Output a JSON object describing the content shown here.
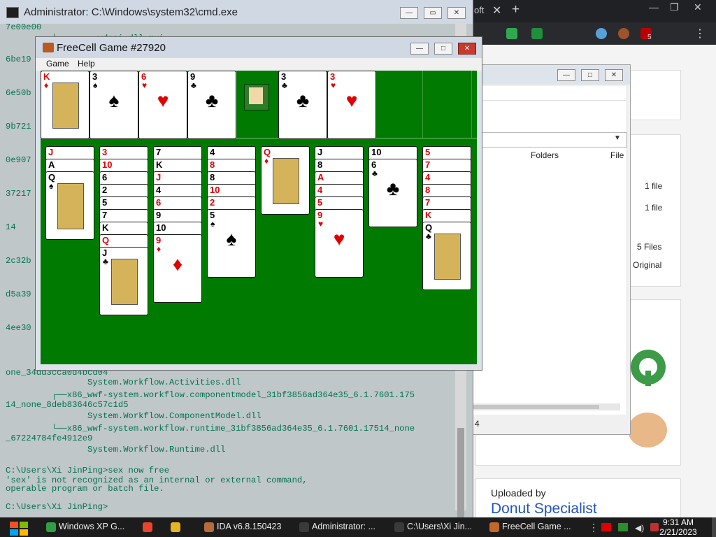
{
  "browser": {
    "tab_fragment": "oft",
    "close_tab": "✕",
    "new_tab": "+",
    "minimize": "—",
    "restore": "❐",
    "close": "✕",
    "badge_count": "5",
    "uploaded_by_label": "Uploaded by",
    "uploader_name": "Donut Specialist"
  },
  "explorer": {
    "columns": {
      "folders": "Folders",
      "file": "File"
    },
    "rows": [
      "1 file",
      "1 file",
      "5 Files",
      "Original"
    ],
    "status": "4",
    "minimize": "—",
    "maximize": "□",
    "close": "✕"
  },
  "cmd": {
    "title": "Administrator: C:\\Windows\\system32\\cmd.exe",
    "minimize": "—",
    "maximize": "▭",
    "close": "✕",
    "lines": [
      "7e00e00",
      "         │        wdapi.dll.mui",
      "6be19",
      "6e50b",
      "9b721",
      "0e907",
      "37217",
      "14",
      "2c32b",
      "d5a39",
      "4ee30",
      "one_34dd3cca0d4bcd04",
      "                System.Workflow.Activities.dll",
      "         ┌──x86_wwf-system.workflow.componentmodel_31bf3856ad364e35_6.1.7601.175",
      "14_none_8deb83646c57c1d5",
      "                System.Workflow.ComponentModel.dll",
      "         └──x86_wwf-system.workflow.runtime_31bf3856ad364e35_6.1.7601.17514_none",
      "_67224784fe4912e9",
      "                System.Workflow.Runtime.dll",
      "",
      "C:\\Users\\Xi JinPing>sex now free",
      "'sex' is not recognized as an internal or external command,",
      "operable program or batch file.",
      "",
      "C:\\Users\\Xi JinPing>"
    ]
  },
  "freecell": {
    "title": "FreeCell Game #27920",
    "menu": [
      "Game",
      "Help"
    ],
    "free_cells": [
      {
        "rank": "K",
        "suit": "♦",
        "color": "red"
      },
      {
        "rank": "3",
        "suit": "♠",
        "color": "blk"
      },
      {
        "rank": "6",
        "suit": "♥",
        "color": "red"
      },
      {
        "rank": "9",
        "suit": "♣",
        "color": "blk"
      }
    ],
    "foundations": [
      {
        "rank": "3",
        "suit": "♣",
        "color": "blk"
      },
      {
        "rank": "3",
        "suit": "♥",
        "color": "red"
      },
      null,
      null
    ],
    "columns": [
      [
        {
          "rank": "J",
          "suit": "♦",
          "color": "red"
        },
        {
          "rank": "A",
          "suit": "♠",
          "color": "blk"
        },
        {
          "rank": "Q",
          "suit": "♠",
          "color": "blk"
        }
      ],
      [
        {
          "rank": "3",
          "suit": "♦",
          "color": "red"
        },
        {
          "rank": "10",
          "suit": "♦",
          "color": "red"
        },
        {
          "rank": "6",
          "suit": "♠",
          "color": "blk"
        },
        {
          "rank": "2",
          "suit": "♠",
          "color": "blk"
        },
        {
          "rank": "5",
          "suit": "♠",
          "color": "blk"
        },
        {
          "rank": "7",
          "suit": "♠",
          "color": "blk"
        },
        {
          "rank": "K",
          "suit": "♠",
          "color": "blk"
        },
        {
          "rank": "Q",
          "suit": "♥",
          "color": "red"
        },
        {
          "rank": "J",
          "suit": "♣",
          "color": "blk"
        }
      ],
      [
        {
          "rank": "7",
          "suit": "♠",
          "color": "blk"
        },
        {
          "rank": "K",
          "suit": "♠",
          "color": "blk"
        },
        {
          "rank": "J",
          "suit": "♥",
          "color": "red"
        },
        {
          "rank": "4",
          "suit": "♠",
          "color": "blk"
        },
        {
          "rank": "6",
          "suit": "♦",
          "color": "red"
        },
        {
          "rank": "9",
          "suit": "♣",
          "color": "blk"
        },
        {
          "rank": "10",
          "suit": "♠",
          "color": "blk"
        },
        {
          "rank": "9",
          "suit": "♦",
          "color": "red"
        }
      ],
      [
        {
          "rank": "4",
          "suit": "♠",
          "color": "blk"
        },
        {
          "rank": "8",
          "suit": "♥",
          "color": "red"
        },
        {
          "rank": "8",
          "suit": "♠",
          "color": "blk"
        },
        {
          "rank": "10",
          "suit": "♥",
          "color": "red"
        },
        {
          "rank": "2",
          "suit": "♥",
          "color": "red"
        },
        {
          "rank": "5",
          "suit": "♠",
          "color": "blk"
        }
      ],
      [
        {
          "rank": "Q",
          "suit": "♦",
          "color": "red"
        }
      ],
      [
        {
          "rank": "J",
          "suit": "♠",
          "color": "blk"
        },
        {
          "rank": "8",
          "suit": "♣",
          "color": "blk"
        },
        {
          "rank": "A",
          "suit": "♦",
          "color": "red"
        },
        {
          "rank": "4",
          "suit": "♦",
          "color": "red"
        },
        {
          "rank": "5",
          "suit": "♦",
          "color": "red"
        },
        {
          "rank": "9",
          "suit": "♥",
          "color": "red"
        }
      ],
      [
        {
          "rank": "10",
          "suit": "♠",
          "color": "blk"
        },
        {
          "rank": "6",
          "suit": "♣",
          "color": "blk"
        }
      ],
      [
        {
          "rank": "5",
          "suit": "♦",
          "color": "red"
        },
        {
          "rank": "7",
          "suit": "♥",
          "color": "red"
        },
        {
          "rank": "4",
          "suit": "♥",
          "color": "red"
        },
        {
          "rank": "8",
          "suit": "♦",
          "color": "red"
        },
        {
          "rank": "7",
          "suit": "♦",
          "color": "red"
        },
        {
          "rank": "K",
          "suit": "♦",
          "color": "red"
        },
        {
          "rank": "Q",
          "suit": "♣",
          "color": "blk"
        }
      ]
    ]
  },
  "taskbar": {
    "items": [
      {
        "label": "Windows XP G...",
        "icon": "chat-icon",
        "color": "#2f9e44"
      },
      {
        "label": "",
        "icon": "chrome-icon",
        "color": "#e8452c"
      },
      {
        "label": "",
        "icon": "folder-icon",
        "color": "#e6b422"
      },
      {
        "label": "IDA v6.8.150423",
        "icon": "ida-icon",
        "color": "#b56b3a"
      },
      {
        "label": "Administrator: ...",
        "icon": "cmd-icon",
        "color": "#3a3a3a"
      },
      {
        "label": "C:\\Users\\Xi Jin...",
        "icon": "cmd-icon",
        "color": "#3a3a3a"
      },
      {
        "label": "FreeCell Game ...",
        "icon": "freecell-icon",
        "color": "#c0692b"
      }
    ],
    "time": "9:31 AM",
    "date": "2/21/2023"
  }
}
